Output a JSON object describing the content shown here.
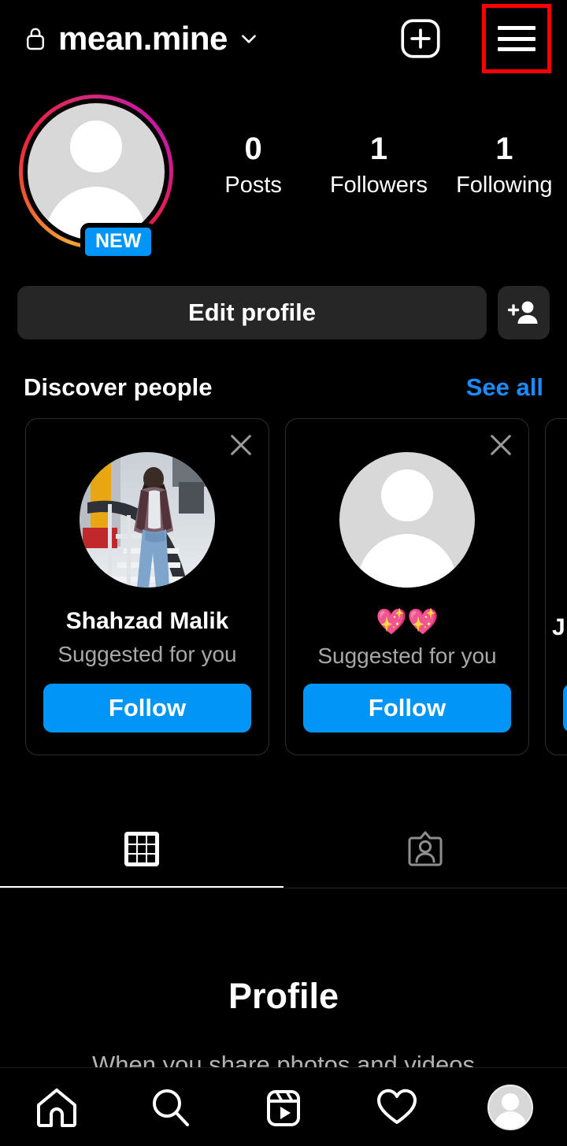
{
  "topbar": {
    "lock_icon": "lock-icon",
    "username": "mean.mine",
    "chevron_icon": "chevron-down-icon",
    "add_post_icon": "plus-box-icon",
    "menu_icon": "hamburger-menu-icon",
    "highlight_color": "#ff0000"
  },
  "profile": {
    "avatar_badge": "NEW",
    "story_ring_colors": [
      "#f0a43a",
      "#f05a30",
      "#e8203f",
      "#d62976",
      "#c9199e"
    ],
    "stats": [
      {
        "value": "0",
        "label": "Posts"
      },
      {
        "value": "1",
        "label": "Followers"
      },
      {
        "value": "1",
        "label": "Following"
      }
    ]
  },
  "actions": {
    "edit_profile_label": "Edit profile",
    "add_person_icon": "add-person-icon"
  },
  "discover": {
    "title": "Discover people",
    "see_all_label": "See all",
    "see_all_color": "#1a8cff",
    "cards": [
      {
        "name": "Shahzad Malik",
        "subtitle": "Suggested for you",
        "follow_label": "Follow",
        "avatar_type": "photo",
        "close_icon": "close-icon"
      },
      {
        "name": "💖💖",
        "subtitle": "Suggested for you",
        "follow_label": "Follow",
        "avatar_type": "placeholder",
        "close_icon": "close-icon"
      },
      {
        "name": "J",
        "subtitle": "",
        "follow_label": "",
        "avatar_type": "placeholder",
        "close_icon": "close-icon"
      }
    ],
    "follow_color": "#0095f6"
  },
  "tabs": [
    {
      "icon": "grid-icon",
      "name": "posts-tab",
      "active": true
    },
    {
      "icon": "tagged-icon",
      "name": "tagged-tab",
      "active": false
    }
  ],
  "empty_state": {
    "title": "Profile",
    "subtitle": "When you share photos and videos"
  },
  "bottomnav": [
    {
      "icon": "home-icon",
      "name": "nav-home"
    },
    {
      "icon": "search-icon",
      "name": "nav-search"
    },
    {
      "icon": "reels-icon",
      "name": "nav-reels"
    },
    {
      "icon": "heart-icon",
      "name": "nav-activity"
    },
    {
      "icon": "profile-avatar-icon",
      "name": "nav-profile"
    }
  ]
}
